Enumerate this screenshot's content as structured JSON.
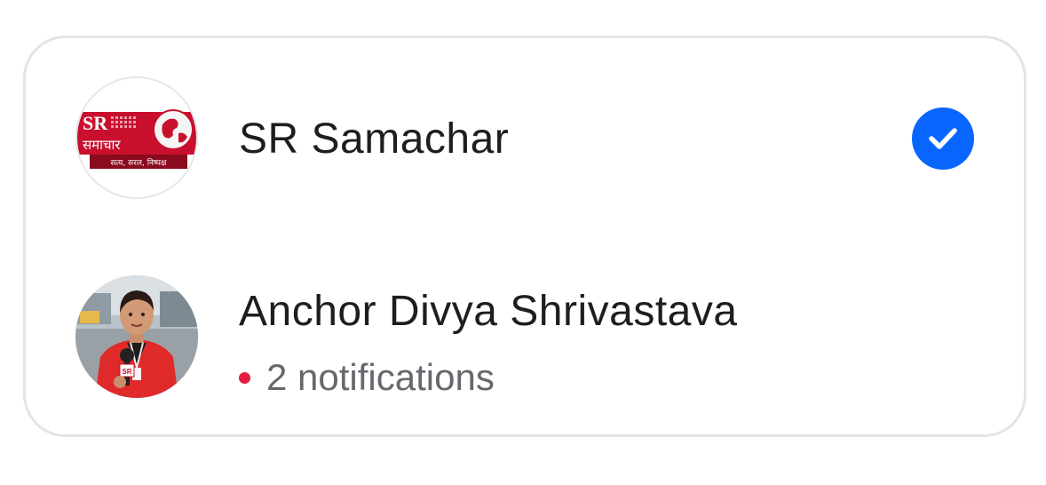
{
  "accounts": [
    {
      "name": "SR Samachar",
      "selected": true,
      "logo": {
        "brand": "SR",
        "hindi_name": "समाचार",
        "tagline": "सत्य, सरल, निष्पक्ष"
      }
    },
    {
      "name": "Anchor Divya Shrivastava",
      "selected": false,
      "notifications": "2 notifications",
      "mic_label": "SR"
    }
  ],
  "colors": {
    "accent_blue": "#0866ff",
    "notification_red": "#e41e3f",
    "text_primary": "#1c1e21",
    "text_secondary": "#65686c",
    "border": "#e1e4e8",
    "brand_red": "#c8102e"
  },
  "icons": {
    "selected": "check-circle-icon",
    "notification": "red-dot-icon"
  }
}
